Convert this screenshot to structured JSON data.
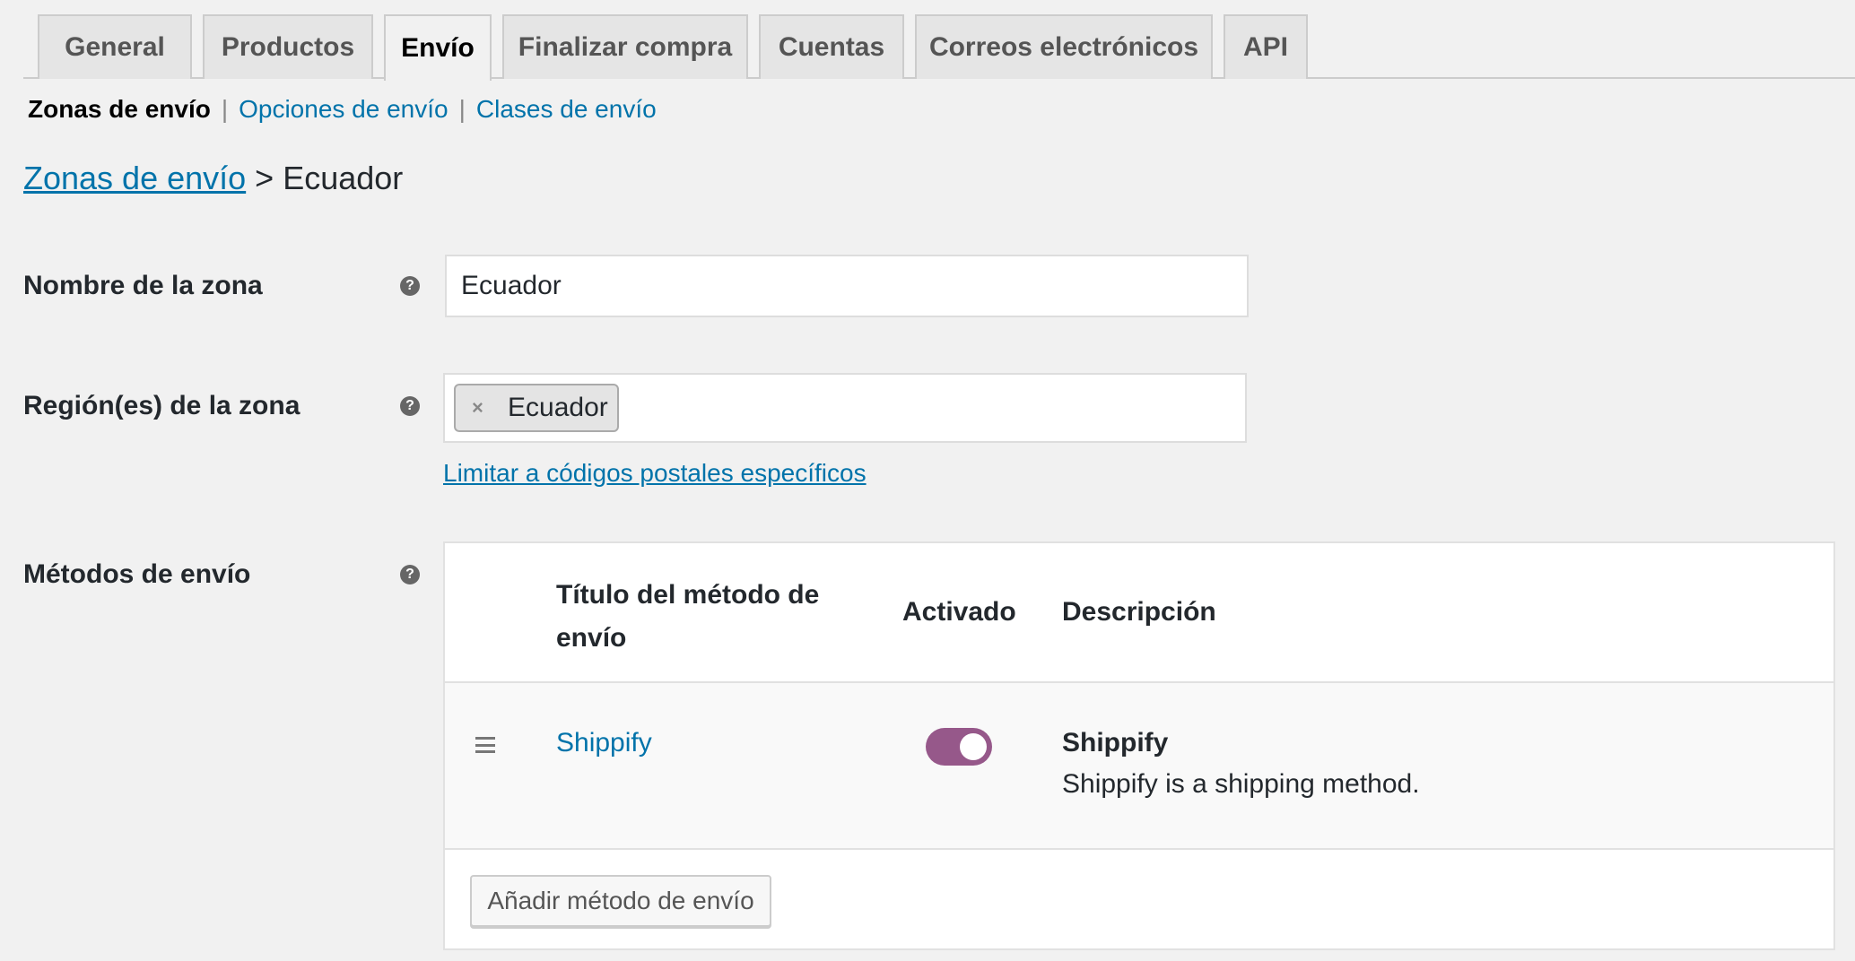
{
  "tabs": [
    {
      "label": "General"
    },
    {
      "label": "Productos"
    },
    {
      "label": "Envío"
    },
    {
      "label": "Finalizar compra"
    },
    {
      "label": "Cuentas"
    },
    {
      "label": "Correos electrónicos"
    },
    {
      "label": "API"
    }
  ],
  "active_tab": "Envío",
  "subnav": {
    "current": "Zonas de envío",
    "separator": "|",
    "links": [
      "Opciones de envío",
      "Clases de envío"
    ]
  },
  "breadcrumb": {
    "link": "Zonas de envío",
    "separator": ">",
    "current": "Ecuador"
  },
  "fields": {
    "zone_name": {
      "label": "Nombre de la zona",
      "value": "Ecuador"
    },
    "zone_regions": {
      "label": "Región(es) de la zona",
      "token_remove": "×",
      "tokens": [
        "Ecuador"
      ],
      "postcode_link": "Limitar a códigos postales específicos"
    },
    "shipping_methods": {
      "label": "Métodos de envío"
    }
  },
  "help_icon": "?",
  "methods_table": {
    "headers": {
      "title": "Título del método de envío",
      "enabled": "Activado",
      "description": "Descripción"
    },
    "rows": [
      {
        "title": "Shippify",
        "enabled": true,
        "description_title": "Shippify",
        "description_text": "Shippify is a shipping method."
      }
    ],
    "add_button": "Añadir método de envío"
  },
  "colors": {
    "link": "#0073aa",
    "toggle_on": "#96588a",
    "background": "#f1f1f1"
  }
}
